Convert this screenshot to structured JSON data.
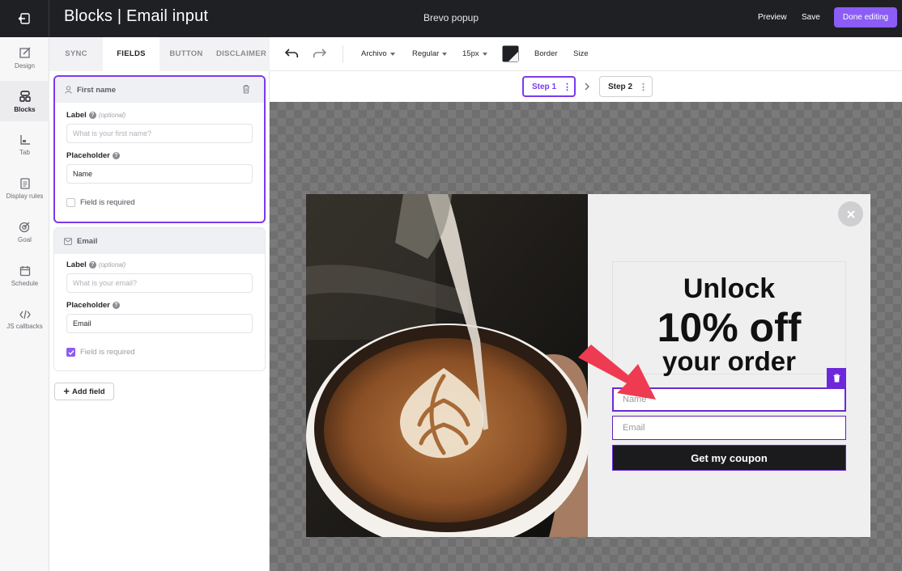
{
  "topbar": {
    "title": "Blocks | Email input",
    "popup_name": "Brevo popup",
    "preview": "Preview",
    "save": "Save",
    "done": "Done editing"
  },
  "rail": {
    "items": [
      {
        "label": "Design",
        "icon": "design-icon"
      },
      {
        "label": "Blocks",
        "icon": "blocks-icon",
        "active": true
      },
      {
        "label": "Tab",
        "icon": "tab-icon"
      },
      {
        "label": "Display rules",
        "icon": "display-rules-icon"
      },
      {
        "label": "Goal",
        "icon": "goal-icon"
      },
      {
        "label": "Schedule",
        "icon": "schedule-icon"
      },
      {
        "label": "JS callbacks",
        "icon": "code-icon"
      }
    ]
  },
  "panel": {
    "tabs": [
      {
        "label": "SYNC"
      },
      {
        "label": "FIELDS",
        "active": true
      },
      {
        "label": "BUTTON"
      },
      {
        "label": "DISCLAIMER"
      }
    ],
    "fields": [
      {
        "title": "First name",
        "label_caption": "Label",
        "optional": "(optional)",
        "label_placeholder": "What is your first name?",
        "placeholder_caption": "Placeholder",
        "placeholder_value": "Name",
        "required_label": "Field is required",
        "required": false
      },
      {
        "title": "Email",
        "label_caption": "Label",
        "optional": "(optional)",
        "label_placeholder": "What is your email?",
        "placeholder_caption": "Placeholder",
        "placeholder_value": "Email",
        "required_label": "Field is required",
        "required": true
      }
    ],
    "add_field": "Add field"
  },
  "toolbar": {
    "font": "Archivo",
    "weight": "Regular",
    "size": "15px",
    "border": "Border",
    "size_label": "Size"
  },
  "steps": {
    "step1": "Step 1",
    "step2": "Step 2"
  },
  "popup": {
    "headline_1": "Unlock",
    "headline_2": "10% off",
    "headline_3": "your order",
    "name_placeholder": "Name",
    "email_placeholder": "Email",
    "cta": "Get my coupon"
  },
  "colors": {
    "accent": "#8b5cf6",
    "selection": "#6d28d9",
    "topbar": "#1f2024",
    "arrow": "#ee3b52"
  }
}
